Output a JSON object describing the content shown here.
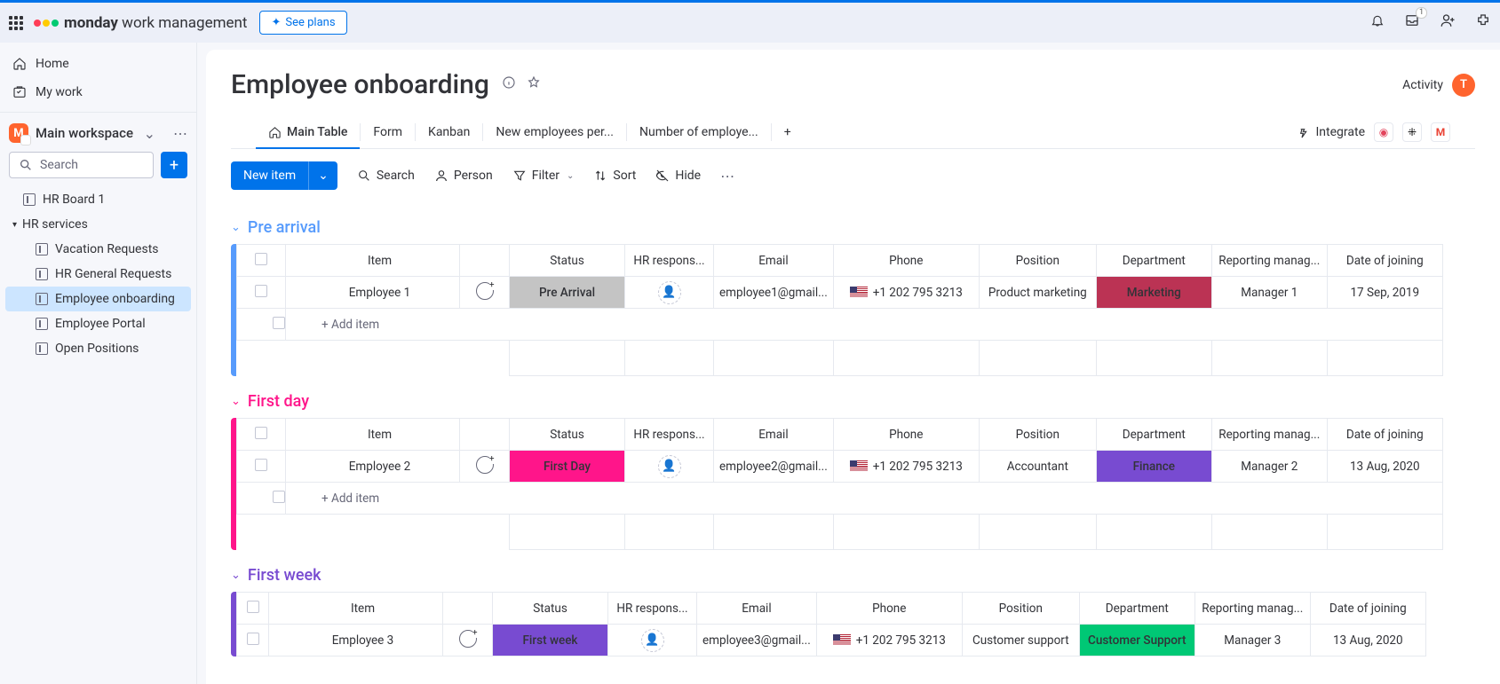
{
  "topbar": {
    "brand_bold": "monday",
    "brand_rest": " work management",
    "see_plans": "See plans",
    "inbox_badge": "1"
  },
  "sidebar": {
    "home": "Home",
    "mywork": "My work",
    "workspace": "Main workspace",
    "search_placeholder": "Search",
    "items": [
      {
        "label": "HR Board 1"
      },
      {
        "label": "HR services",
        "folder": true
      },
      {
        "label": "Vacation Requests",
        "child": true
      },
      {
        "label": "HR General Requests",
        "child": true
      },
      {
        "label": "Employee onboarding",
        "child": true,
        "active": true
      },
      {
        "label": "Employee Portal",
        "child": true
      },
      {
        "label": "Open Positions",
        "child": true
      }
    ]
  },
  "header": {
    "title": "Employee onboarding",
    "activity": "Activity",
    "avatar": "T"
  },
  "tabs": [
    "Main Table",
    "Form",
    "Kanban",
    "New employees per...",
    "Number of employe..."
  ],
  "integrate": "Integrate",
  "toolbar": {
    "new_item": "New item",
    "search": "Search",
    "person": "Person",
    "filter": "Filter",
    "sort": "Sort",
    "hide": "Hide"
  },
  "columns": [
    "Item",
    "Status",
    "HR respons...",
    "Email",
    "Phone",
    "Position",
    "Department",
    "Reporting manag...",
    "Date of joining"
  ],
  "add_item": "+ Add item",
  "groups": [
    {
      "name": "Pre arrival",
      "color": "#579bfc",
      "rows": [
        {
          "item": "Employee 1",
          "status": "Pre Arrival",
          "status_bg": "#c4c4c4",
          "email": "employee1@gmail...",
          "phone": "+1 202 795 3213",
          "position": "Product marketing",
          "dept": "Marketing",
          "dept_bg": "#bb3354",
          "manager": "Manager 1",
          "date": "17 Sep, 2019"
        }
      ]
    },
    {
      "name": "First day",
      "color": "#ff158a",
      "rows": [
        {
          "item": "Employee 2",
          "status": "First Day",
          "status_bg": "#ff158a",
          "email": "employee2@gmail...",
          "phone": "+1 202 795 3213",
          "position": "Accountant",
          "dept": "Finance",
          "dept_bg": "#784bd1",
          "manager": "Manager 2",
          "date": "13 Aug, 2020"
        }
      ]
    },
    {
      "name": "First week",
      "color": "#784bd1",
      "rows": [
        {
          "item": "Employee 3",
          "status": "First week",
          "status_bg": "#784bd1",
          "email": "employee3@gmail...",
          "phone": "+1 202 795 3213",
          "position": "Customer support",
          "dept": "Customer Support",
          "dept_bg": "#00c875",
          "manager": "Manager 3",
          "date": "13 Aug, 2020"
        }
      ]
    }
  ]
}
